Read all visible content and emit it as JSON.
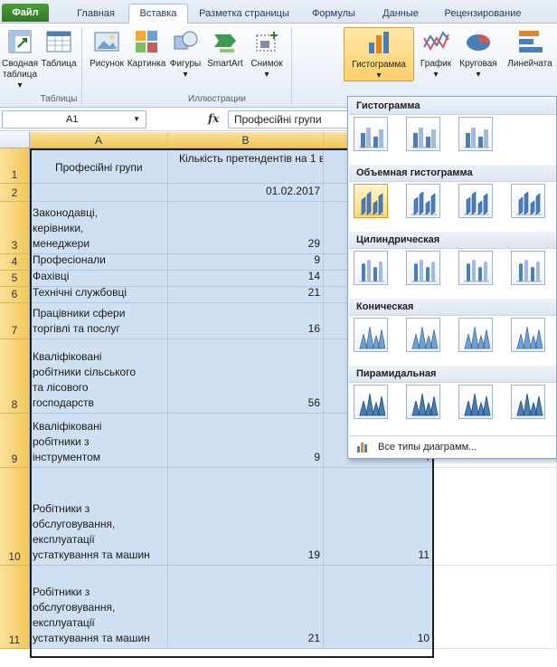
{
  "ribbon_tabs": [
    "Файл",
    "Главная",
    "Вставка",
    "Разметка страницы",
    "Формулы",
    "Данные",
    "Рецензирование"
  ],
  "active_tab": "Вставка",
  "ribbon": {
    "pivot": "Сводная\nтаблица ▾",
    "table": "Таблица",
    "picture": "Рисунок",
    "clipart": "Картинка",
    "shapes": "Фигуры\n▾",
    "smartart": "SmartArt",
    "screenshot": "Снимок\n▾",
    "column_chart": "Гистограмма\n▾",
    "line_chart": "График\n▾",
    "pie_chart": "Круговая\n▾",
    "bar_chart": "Линейчата",
    "group_tables": "Таблицы",
    "group_illustrations": "Иллюстрации"
  },
  "formula_bar": {
    "name_box": "A1",
    "fx": "fx",
    "content": "Професійні групи"
  },
  "columns": [
    "A",
    "B"
  ],
  "rows": [
    {
      "num": "1",
      "a": "Професійні групи",
      "b": "Кількість претендентів на 1 в",
      "c": ""
    },
    {
      "num": "2",
      "a": "",
      "b": "01.02.2017",
      "c": ""
    },
    {
      "num": "3",
      "a": "Законодавці,\nкерівники,\nменеджери",
      "b": "29",
      "c": ""
    },
    {
      "num": "4",
      "a": "Професіонали",
      "b": "9",
      "c": ""
    },
    {
      "num": "5",
      "a": "Фахівці",
      "b": "14",
      "c": ""
    },
    {
      "num": "6",
      "a": "Технічні службовці",
      "b": "21",
      "c": ""
    },
    {
      "num": "7",
      "a": "Працівники сфери\nторгівлі та послуг",
      "b": "16",
      "c": ""
    },
    {
      "num": "8",
      "a": "Кваліфіковані\nробітники сільського\nта лісового\nгосподарств",
      "b": "56",
      "c": ""
    },
    {
      "num": "9",
      "a": "Кваліфіковані\nробітники з\nінструментом",
      "b": "9",
      "c": "4"
    },
    {
      "num": "10",
      "a": "Робітники з\nобслуговування,\nексплуатації\nустаткування та машин",
      "b": "19",
      "c": "11"
    },
    {
      "num": "11",
      "a": "Робітники з\nобслуговування,\nексплуатації\nустаткування та машин",
      "b": "21",
      "c": "10"
    }
  ],
  "gallery": {
    "sections": [
      "Гистограмма",
      "Объемная гистограмма",
      "Цилиндрическая",
      "Коническая",
      "Пирамидальная"
    ],
    "all_types": "Все типы диаграмм...",
    "all_types_underline": "В"
  },
  "colors": {
    "selection_fill": "#cfe0f3",
    "header_selected": "#f3c758",
    "file_tab": "#2f7a25",
    "accent_blue": "#4a7ebb"
  }
}
